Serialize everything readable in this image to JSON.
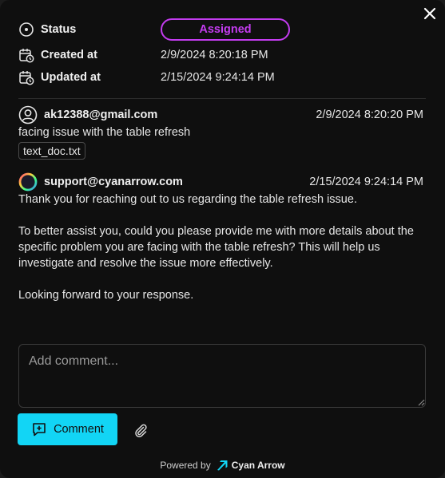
{
  "status": {
    "label": "Status",
    "value": "Assigned",
    "color": "#c43cf0"
  },
  "created": {
    "label": "Created at",
    "value": "2/9/2024 8:20:18 PM"
  },
  "updated": {
    "label": "Updated at",
    "value": "2/15/2024 9:24:14 PM"
  },
  "messages": [
    {
      "author": "ak12388@gmail.com",
      "time": "2/9/2024 8:20:20 PM",
      "text": "facing issue with the table refresh",
      "attachment": "text_doc.txt"
    },
    {
      "author": "support@cyanarrow.com",
      "time": "2/15/2024 9:24:14 PM",
      "para1": "Thank you for reaching out to us regarding the table refresh issue.",
      "para2": "To better assist you, could you please provide me with more details about the specific problem you are facing with the table refresh? This will help us investigate and resolve the issue more effectively.",
      "para3": "Looking forward to your response."
    }
  ],
  "composer": {
    "placeholder": "Add comment...",
    "submit_label": "Comment"
  },
  "footer": {
    "powered_by": "Powered by",
    "brand": "Cyan Arrow"
  },
  "colors": {
    "accent": "#12d5f5",
    "background": "#0f0f0f"
  }
}
